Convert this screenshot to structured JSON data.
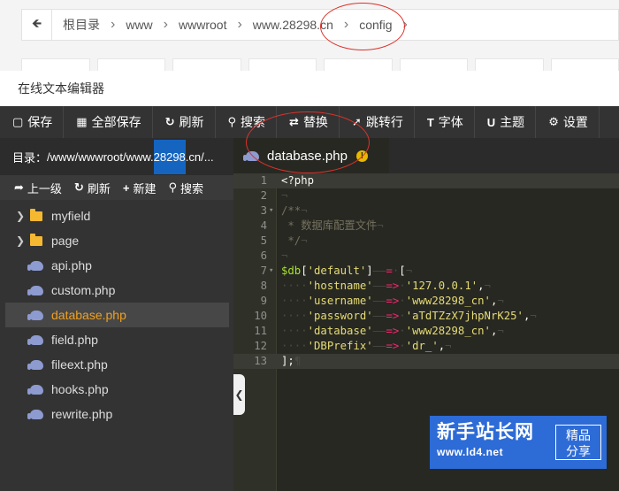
{
  "breadcrumb": {
    "back_icon": "arrow-left-icon",
    "segments": [
      "根目录",
      "www",
      "wwwroot",
      "www.28298.cn",
      "config"
    ]
  },
  "window": {
    "title": "在线文本编辑器"
  },
  "toolbar": {
    "save": "保存",
    "save_all": "全部保存",
    "refresh": "刷新",
    "search": "搜索",
    "replace": "替换",
    "goto_line": "跳转行",
    "font": "字体",
    "theme": "主题",
    "settings": "设置"
  },
  "sidebar": {
    "dir_label": "目录：",
    "dir_path_pre": "/www/wwwroot/www.",
    "dir_path_hl": "28298",
    "dir_path_post": ".cn/...",
    "up_label": "上一级",
    "refresh_label": "刷新",
    "new_label": "新建",
    "search_label": "搜索",
    "items": [
      {
        "name": "myfield",
        "type": "folder"
      },
      {
        "name": "page",
        "type": "folder"
      },
      {
        "name": "api.php",
        "type": "file"
      },
      {
        "name": "custom.php",
        "type": "file"
      },
      {
        "name": "database.php",
        "type": "file",
        "selected": true
      },
      {
        "name": "field.php",
        "type": "file"
      },
      {
        "name": "fileext.php",
        "type": "file"
      },
      {
        "name": "hooks.php",
        "type": "file"
      },
      {
        "name": "rewrite.php",
        "type": "file"
      }
    ]
  },
  "editor": {
    "tab_title": "database.php",
    "tab_warning": "!",
    "line_numbers": [
      "1",
      "2",
      "3",
      "4",
      "5",
      "6",
      "7",
      "8",
      "9",
      "10",
      "11",
      "12",
      "13"
    ],
    "lines": {
      "l1": "<?php",
      "l3": "/**",
      "l4": " * 数据库配置文件",
      "l5": " */",
      "l7_var": "$db",
      "l7_key": "'default'",
      "l8_key": "'hostname'",
      "l8_val": "'127.0.0.1'",
      "l9_key": "'username'",
      "l9_val": "'www28298_cn'",
      "l10_key": "'password'",
      "l10_val": "'aTdTZzX7jhpNrK25'",
      "l11_key": "'database'",
      "l11_val": "'www28298_cn'",
      "l12_key": "'DBPrefix'",
      "l12_val": "'dr_'",
      "l13": "];"
    }
  },
  "watermark": {
    "big": "新手站长网",
    "small": "www.ld4.net",
    "badge1": "精品",
    "badge2": "分享"
  }
}
